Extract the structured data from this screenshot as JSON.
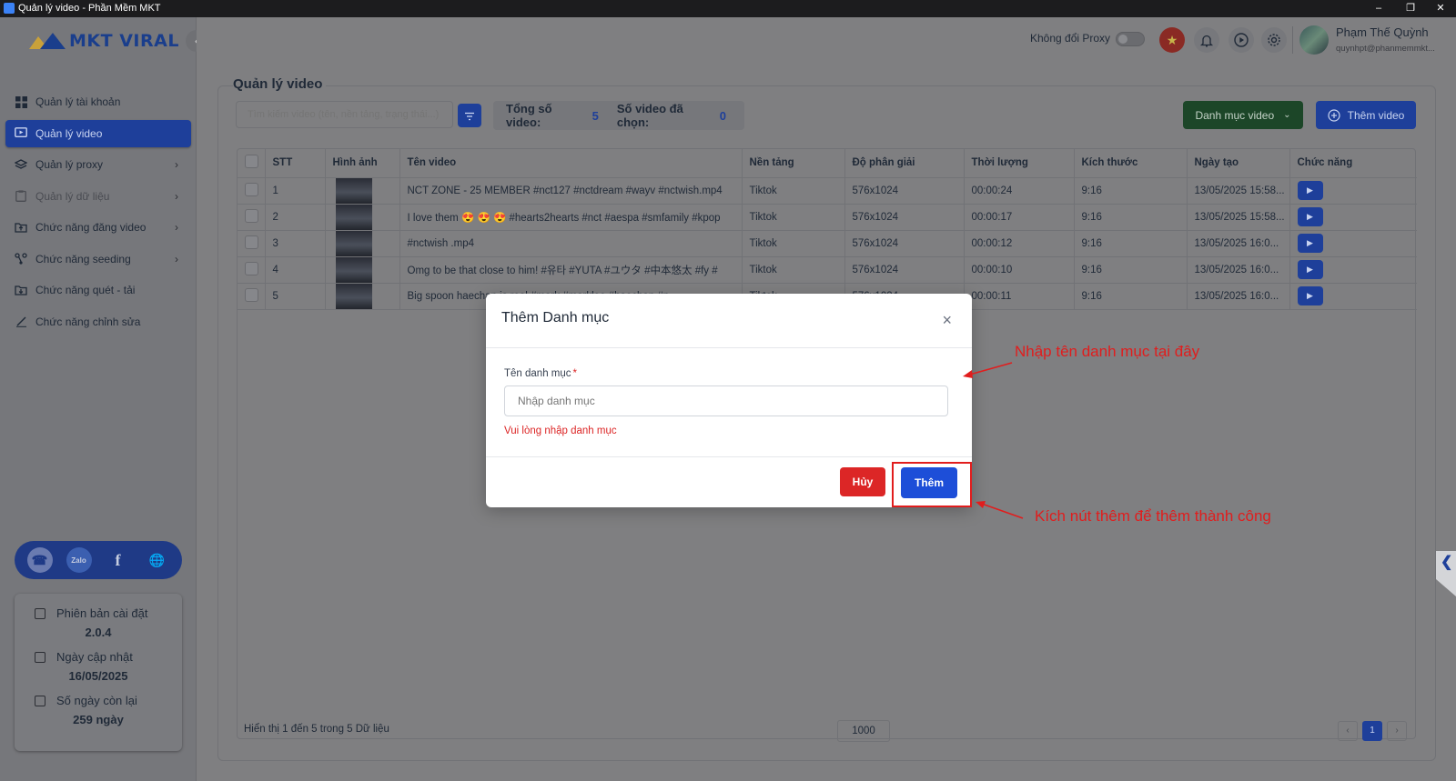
{
  "window": {
    "title": "Quản lý video - Phần Mềm MKT",
    "minimize": "–",
    "restore": "❐",
    "close": "✕"
  },
  "sidebar": {
    "logo_text": "MKT VIRAL",
    "collapse_icon": "‹",
    "items": [
      {
        "label": "Quản lý tài khoản",
        "icon": "grid-icon",
        "chevron": ""
      },
      {
        "label": "Quản lý video",
        "icon": "video-icon",
        "chevron": ""
      },
      {
        "label": "Quản lý proxy",
        "icon": "layers-icon",
        "chevron": "›"
      },
      {
        "label": "Quản lý dữ liệu",
        "icon": "clipboard-icon",
        "chevron": "›"
      },
      {
        "label": "Chức năng đăng video",
        "icon": "upload-icon",
        "chevron": "›"
      },
      {
        "label": "Chức năng seeding",
        "icon": "share-icon",
        "chevron": "›"
      },
      {
        "label": "Chức năng quét - tải",
        "icon": "download-icon",
        "chevron": ""
      },
      {
        "label": "Chức năng chỉnh sửa",
        "icon": "edit-icon",
        "chevron": ""
      }
    ],
    "social": {
      "support": "☎",
      "zalo": "Zalo",
      "facebook": "f",
      "web": "🌐"
    },
    "info": {
      "version_label": "Phiên bản cài đặt",
      "version_value": "2.0.4",
      "updated_label": "Ngày cập nhật",
      "updated_value": "16/05/2025",
      "days_label": "Số ngày còn lại",
      "days_value": "259 ngày"
    }
  },
  "topbar": {
    "proxy_label": "Không đổi Proxy",
    "proxy_enabled": false,
    "user_name": "Phạm Thế Quỳnh",
    "user_email": "quynhpt@phanmemmkt..."
  },
  "page": {
    "title": "Quản lý video",
    "search_placeholder": "Tìm kiếm video (tên, nền tảng, trạng thái...)",
    "stats": {
      "total_label": "Tổng số video:",
      "total_value": "5",
      "selected_label": "Số video đã chọn:",
      "selected_value": "0"
    },
    "category_button": "Danh mục video",
    "add_button": "Thêm video"
  },
  "table": {
    "headers": [
      "STT",
      "Hình ảnh",
      "Tên video",
      "Nền tảng",
      "Độ phân giải",
      "Thời lượng",
      "Kích thước",
      "Ngày tạo",
      "Chức năng"
    ],
    "rows": [
      {
        "stt": "1",
        "name": "NCT ZONE - 25 MEMBER #nct127 #nctdream #wayv #nctwish.mp4",
        "platform": "Tiktok",
        "resolution": "576x1024",
        "duration": "00:00:24",
        "size": "9:16",
        "created": "13/05/2025 15:58..."
      },
      {
        "stt": "2",
        "name": "I love them 😍 😍 😍 #hearts2hearts #nct #aespa #smfamily #kpop",
        "platform": "Tiktok",
        "resolution": "576x1024",
        "duration": "00:00:17",
        "size": "9:16",
        "created": "13/05/2025 15:58..."
      },
      {
        "stt": "3",
        "name": "#nctwish .mp4",
        "platform": "Tiktok",
        "resolution": "576x1024",
        "duration": "00:00:12",
        "size": "9:16",
        "created": "13/05/2025 16:0..."
      },
      {
        "stt": "4",
        "name": "Omg to be that close to him! #유타 #YUTA #ユウタ #中本悠太 #fy #",
        "platform": "Tiktok",
        "resolution": "576x1024",
        "duration": "00:00:10",
        "size": "9:16",
        "created": "13/05/2025 16:0..."
      },
      {
        "stt": "5",
        "name": "Big spoon haechan is real #mark #marklee #haechan #n",
        "platform": "Tiktok",
        "resolution": "576x1024",
        "duration": "00:00:11",
        "size": "9:16",
        "created": "13/05/2025 16:0..."
      }
    ],
    "footer_info": "Hiển thị 1 đến 5 trong 5 Dữ liệu",
    "page_size": "1000",
    "prev": "‹",
    "current_page": "1",
    "next": "›"
  },
  "modal": {
    "title": "Thêm Danh mục",
    "close": "×",
    "field_label": "Tên danh mục",
    "required_mark": "*",
    "field_placeholder": "Nhập danh mục",
    "error": "Vui lòng nhập danh mục",
    "cancel": "Hủy",
    "submit": "Thêm"
  },
  "annotations": {
    "input_hint": "Nhập tên danh mục tại đây",
    "button_hint": "Kích nút thêm để thêm thành công"
  },
  "colors": {
    "accent": "#1e3f9a",
    "danger": "#dc2626",
    "primary": "#1d4ed8",
    "annotation": "#e11d1d",
    "category_button": "#1c4628"
  }
}
